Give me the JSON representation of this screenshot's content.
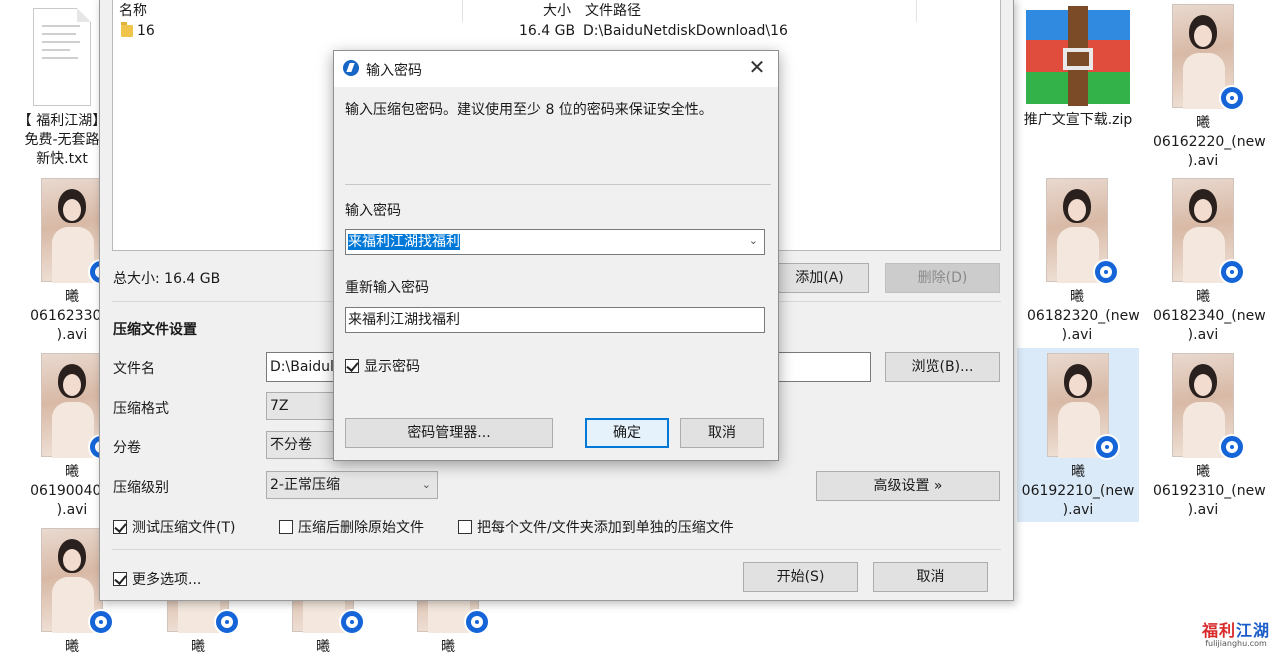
{
  "desktop": {
    "left_icons": [
      {
        "kind": "txt",
        "lines": [
          "【 福利江湖】",
          "免费-无套路",
          "新快.txt"
        ]
      },
      {
        "kind": "video",
        "lines": [
          "曦",
          "06162330_(",
          ").avi"
        ]
      },
      {
        "kind": "video",
        "lines": [
          "曦",
          "06190040_(",
          ").avi"
        ]
      },
      {
        "kind": "video",
        "lines": [
          "曦"
        ]
      }
    ],
    "bottom_icons": [
      {
        "lines": [
          "曦"
        ]
      },
      {
        "lines": [
          "曦"
        ]
      },
      {
        "lines": [
          "曦"
        ]
      }
    ],
    "right_icons": [
      {
        "kind": "zip",
        "lines": [
          "推广文宣下载.zip"
        ]
      },
      {
        "kind": "video",
        "lines": [
          "曦",
          "06162220_(new",
          ").avi"
        ]
      },
      {
        "kind": "video",
        "lines": [
          "曦",
          "06182320_(new",
          ").avi"
        ]
      },
      {
        "kind": "video",
        "lines": [
          "曦",
          "06182340_(new",
          ").avi"
        ]
      },
      {
        "kind": "video",
        "lines": [
          "曦",
          "06192210_(new",
          ").avi"
        ]
      },
      {
        "kind": "video",
        "lines": [
          "曦",
          "06192310_(new",
          ").avi"
        ]
      }
    ]
  },
  "main": {
    "columns": {
      "name": "名称",
      "size": "大小",
      "path": "文件路径"
    },
    "file": {
      "name": "16",
      "size": "16.4 GB",
      "path": "D:\\BaiduNetdiskDownload\\16"
    },
    "total_size": "总大小: 16.4 GB",
    "add_button": "添加(A)",
    "delete_button": "删除(D)",
    "section_title": "压缩文件设置",
    "filename_label": "文件名",
    "filename_value": "D:\\Baidul",
    "browse_button": "浏览(B)...",
    "format_label": "压缩格式",
    "format_value": "7Z",
    "split_label": "分卷",
    "split_value": "不分卷",
    "level_label": "压缩级别",
    "level_value": "2-正常压缩",
    "advanced_button": "高级设置 »",
    "check_test": "测试压缩文件(T)",
    "check_delete": "压缩后删除原始文件",
    "check_each": "把每个文件/文件夹添加到单独的压缩文件",
    "more_options": "更多选项...",
    "start_button": "开始(S)",
    "cancel_button": "取消"
  },
  "dialog": {
    "title": "输入密码",
    "description": "输入压缩包密码。建议使用至少 8 位的密码来保证安全性。",
    "password_label": "输入密码",
    "password_value": "来福利江湖找福利",
    "reenter_label": "重新输入密码",
    "reenter_value": "来福利江湖找福利",
    "show_password": "显示密码",
    "manager_button": "密码管理器...",
    "ok_button": "确定",
    "cancel_button": "取消"
  },
  "watermark": {
    "title_a": "福利",
    "title_b": "江湖",
    "url": "fulijianghu.com"
  },
  "icons": [
    "close-icon",
    "folder-icon",
    "chevron-down-icon",
    "app-icon",
    "video-badge-icon",
    "rar-icon",
    "text-file-icon"
  ],
  "colors": {
    "accent": "#0078d7",
    "selection": "#dbeaf9",
    "badge": "#1565d8"
  }
}
